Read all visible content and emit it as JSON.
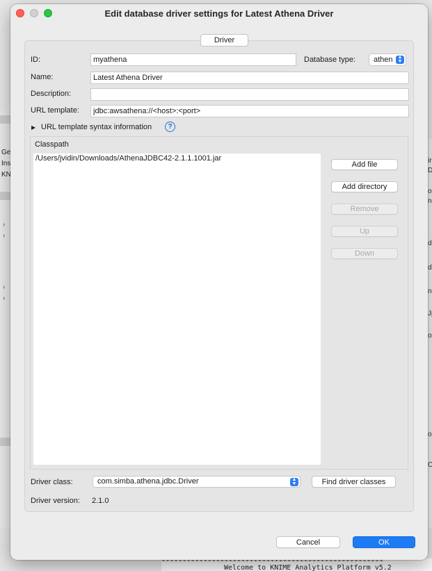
{
  "dialog": {
    "title": "Edit database driver settings for Latest Athena Driver",
    "tab_label": "Driver"
  },
  "form": {
    "id_label": "ID:",
    "id_value": "myathena",
    "db_type_label": "Database type:",
    "db_type_value": "athen",
    "name_label": "Name:",
    "name_value": "Latest Athena Driver",
    "description_label": "Description:",
    "description_value": "",
    "url_label": "URL template:",
    "url_value": "jdbc:awsathena://<host>:<port>",
    "url_info_label": "URL template syntax information",
    "help_icon": "?"
  },
  "classpath": {
    "label": "Classpath",
    "items": [
      "/Users/jvidin/Downloads/AthenaJDBC42-2.1.1.1001.jar"
    ],
    "buttons": {
      "add_file": "Add file",
      "add_directory": "Add directory",
      "remove": "Remove",
      "up": "Up",
      "down": "Down"
    }
  },
  "driver": {
    "class_label": "Driver class:",
    "class_value": "com.simba.athena.jdbc.Driver",
    "find_button": "Find driver classes",
    "version_label": "Driver version:",
    "version_value": "2.1.0"
  },
  "footer": {
    "cancel": "Cancel",
    "ok": "OK"
  },
  "background": {
    "left_texts": [
      "Ge",
      "Ins",
      "KN"
    ],
    "right_texts": [
      "ir",
      "DE",
      "o",
      "ne",
      "d",
      "d",
      "ne",
      "Jp",
      "ov",
      "op",
      "C"
    ],
    "console_line1": "*****************************************************",
    "console_line2": "Welcome to KNIME Analytics Platform v5.2"
  },
  "colors": {
    "primary": "#1d7bf5",
    "close": "#fe5f57",
    "maximize": "#28c840",
    "help": "#1f6fd1"
  }
}
